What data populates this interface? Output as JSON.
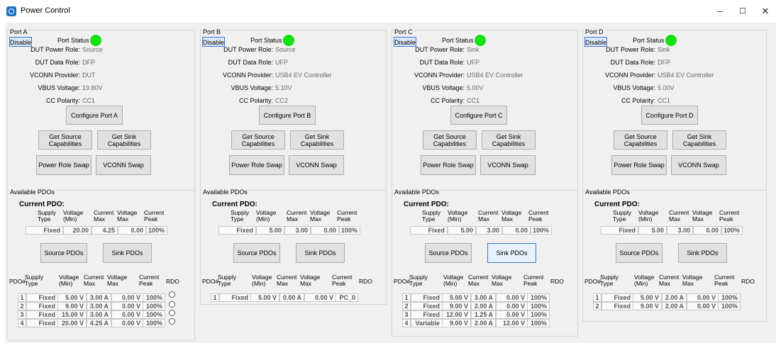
{
  "window": {
    "title": "Power Control",
    "minimize_glyph": "–",
    "maximize_glyph": "☐",
    "close_glyph": "✕"
  },
  "labels": {
    "disable": "Disable",
    "port_status": "Port Status",
    "dut_power_role": "DUT Power Role:",
    "dut_data_role": "DUT Data Role:",
    "vconn_provider": "VCONN Provider:",
    "vbus_voltage": "VBUS Voltage:",
    "cc_polarity": "CC Polarity:",
    "get_source_caps": "Get Source Capabilities",
    "get_sink_caps": "Get Sink Capabilities",
    "power_role_swap": "Power Role Swap",
    "vconn_swap": "VCONN Swap",
    "available_pdos": "Available PDOs",
    "current_pdo": "Current PDO:",
    "source_pdos": "Source PDOs",
    "sink_pdos": "Sink PDOs",
    "hdr_supply": "Supply Type",
    "hdr_voltage_min": "Voltage (Min)",
    "hdr_current_max": "Current Max",
    "hdr_voltage_max": "Voltage Max",
    "hdr_current_peak": "Current Peak",
    "hdr_pdo_num": "PDO#",
    "hdr_rdo": "RDO"
  },
  "ports": [
    {
      "name": "Port A",
      "status_color": "#14e014",
      "power_role": "Source",
      "data_role": "DFP",
      "vconn_provider": "DUT",
      "vbus_voltage": "19.80V",
      "cc_polarity": "CC1",
      "configure_label": "Configure Port A",
      "current_pdo": {
        "type": "Fixed",
        "vmin": "20.00",
        "imax": "4.25",
        "vmax": "0.00",
        "peak": "100%"
      },
      "has_rdo": true,
      "selected_pdo_button": "",
      "pdos": [
        {
          "num": "1",
          "type": "Fixed",
          "vmin": "5.00 V",
          "imax": "3.00 A",
          "vmax": "0.00 V",
          "peak": "100%"
        },
        {
          "num": "2",
          "type": "Fixed",
          "vmin": "9.00 V",
          "imax": "3.00 A",
          "vmax": "0.00 V",
          "peak": "100%"
        },
        {
          "num": "3",
          "type": "Fixed",
          "vmin": "15.00 V",
          "imax": "3.00 A",
          "vmax": "0.00 V",
          "peak": "100%"
        },
        {
          "num": "4",
          "type": "Fixed",
          "vmin": "20.00 V",
          "imax": "4.25 A",
          "vmax": "0.00 V",
          "peak": "100%"
        }
      ]
    },
    {
      "name": "Port B",
      "status_color": "#14e014",
      "power_role": "Source",
      "data_role": "UFP",
      "vconn_provider": "USB4 EV Controller",
      "vbus_voltage": "5.10V",
      "cc_polarity": "CC2",
      "configure_label": "Configure Port B",
      "current_pdo": {
        "type": "Fixed",
        "vmin": "5.00",
        "imax": "3.00",
        "vmax": "0.00",
        "peak": "100%"
      },
      "has_rdo": true,
      "selected_pdo_button": "",
      "pdos": [
        {
          "num": "1",
          "type": "Fixed",
          "vmin": "5.00 V",
          "imax": "0.00 A",
          "vmax": "0.00 V",
          "peak": "PC_0"
        }
      ]
    },
    {
      "name": "Port C",
      "status_color": "#14e014",
      "power_role": "Sink",
      "data_role": "UFP",
      "vconn_provider": "USB4 EV Controller",
      "vbus_voltage": "5.00V",
      "cc_polarity": "CC1",
      "configure_label": "Configure Port C",
      "current_pdo": {
        "type": "Fixed",
        "vmin": "5.00",
        "imax": "3.00",
        "vmax": "0.00",
        "peak": "100%"
      },
      "has_rdo": true,
      "selected_pdo_button": "sink",
      "pdos": [
        {
          "num": "1",
          "type": "Fixed",
          "vmin": "5.00 V",
          "imax": "3.00 A",
          "vmax": "0.00 V",
          "peak": "100%"
        },
        {
          "num": "2",
          "type": "Fixed",
          "vmin": "9.00 V",
          "imax": "2.00 A",
          "vmax": "0.00 V",
          "peak": "100%"
        },
        {
          "num": "3",
          "type": "Fixed",
          "vmin": "12.00 V",
          "imax": "1.25 A",
          "vmax": "0.00 V",
          "peak": "100%"
        },
        {
          "num": "4",
          "type": "Variable",
          "vmin": "9.00 V",
          "imax": "2.00 A",
          "vmax": "12.00 V",
          "peak": "100%"
        }
      ]
    },
    {
      "name": "Port D",
      "status_color": "#14e014",
      "power_role": "Sink",
      "data_role": "DFP",
      "vconn_provider": "USB4 EV Controller",
      "vbus_voltage": "5.00V",
      "cc_polarity": "CC1",
      "configure_label": "Configure Port D",
      "current_pdo": {
        "type": "Fixed",
        "vmin": "5.00",
        "imax": "3.00",
        "vmax": "0.00",
        "peak": "100%"
      },
      "has_rdo": true,
      "selected_pdo_button": "",
      "pdos": [
        {
          "num": "1",
          "type": "Fixed",
          "vmin": "5.00 V",
          "imax": "2.00 A",
          "vmax": "0.00 V",
          "peak": "100%"
        },
        {
          "num": "2",
          "type": "Fixed",
          "vmin": "9.00 V",
          "imax": "2.00 A",
          "vmax": "0.00 V",
          "peak": "100%"
        }
      ]
    }
  ]
}
